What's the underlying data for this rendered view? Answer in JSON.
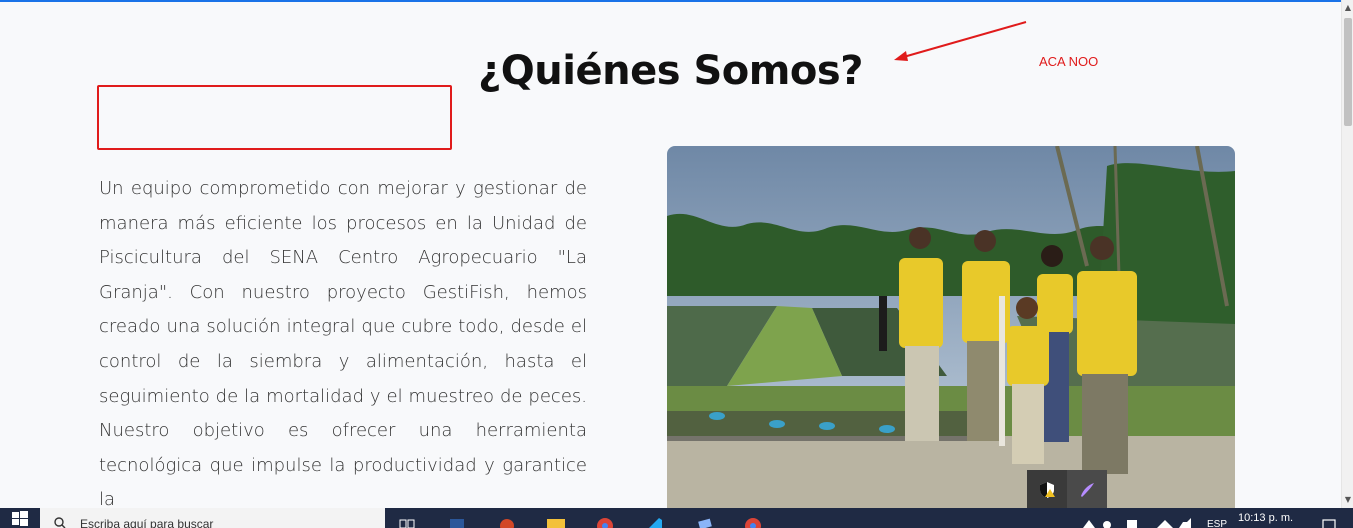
{
  "page": {
    "title": "¿Quiénes Somos?",
    "description": "Un equipo comprometido con mejorar y gestionar de manera más eficiente los procesos en la Unidad de Piscicultura del SENA Centro Agropecuario \"La Granja\". Con nuestro proyecto GestiFish, hemos creado una solución integral que cubre todo, desde el control de la siembra y alimentación, hasta el seguimiento de la mortalidad y el muestreo de peces. Nuestro objetivo es ofrecer una herramienta tecnológica que impulse la productividad y garantice la"
  },
  "annotation": {
    "text": "ACA NOO",
    "color": "#e01b1b"
  },
  "colors": {
    "accent": "#1a73e8",
    "shirt": "#e8c92a",
    "taskbar": "#1f2a44"
  },
  "taskbar": {
    "search_placeholder": "Escriba aquí para buscar",
    "clock_time": "10:13 p. m.",
    "language": "ESP",
    "apps": [
      "task-view-icon",
      "word-icon",
      "powerpoint-icon",
      "file-explorer-icon",
      "chrome-icon",
      "vscode-icon",
      "app-icon",
      "chrome-icon"
    ]
  }
}
